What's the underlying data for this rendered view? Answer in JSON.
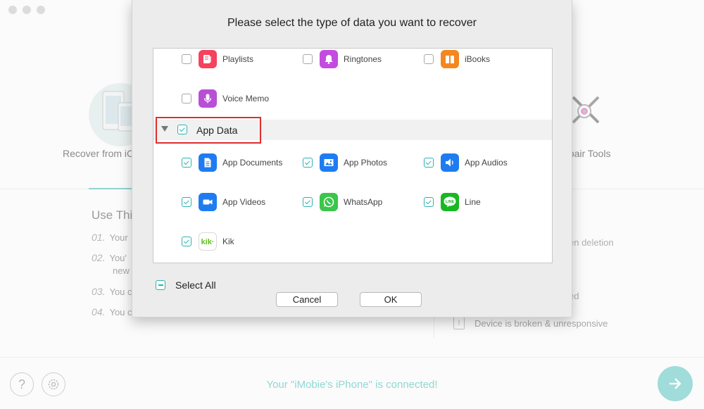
{
  "background": {
    "mode_left_label": "Recover from iC",
    "mode_right_label": "epair Tools",
    "use_heading": "Use Thi",
    "steps": [
      {
        "num": "01.",
        "text": "Your"
      },
      {
        "num": "02.",
        "text": "You'",
        "text2": "new"
      },
      {
        "num": "03.",
        "text": "You c"
      },
      {
        "num": "04.",
        "text": "You c"
      }
    ],
    "right_items": [
      "en deletion",
      "ed"
    ],
    "broken_text": "Device is broken & unresponsive",
    "status": "Your \"iMobie's iPhone\" is connected!"
  },
  "dialog": {
    "title": "Please select the type of data you want to recover",
    "group": {
      "label": "App Data",
      "checked": true
    },
    "top_items": [
      {
        "label": "Playlists",
        "checked": false,
        "icon": "playlists-icon",
        "color": "#f5425e"
      },
      {
        "label": "Ringtones",
        "checked": false,
        "icon": "ringtones-icon",
        "color": "#c44be0"
      },
      {
        "label": "iBooks",
        "checked": false,
        "icon": "ibooks-icon",
        "color": "#f4871f"
      },
      {
        "label": "Voice Memo",
        "checked": false,
        "icon": "voice-memo-icon",
        "color": "#b84fd6"
      }
    ],
    "app_items": [
      {
        "label": "App Documents",
        "checked": true,
        "icon": "app-documents-icon",
        "color": "#1f7cf0"
      },
      {
        "label": "App Photos",
        "checked": true,
        "icon": "app-photos-icon",
        "color": "#1f7cf0"
      },
      {
        "label": "App Audios",
        "checked": true,
        "icon": "app-audios-icon",
        "color": "#1f7cf0"
      },
      {
        "label": "App Videos",
        "checked": true,
        "icon": "app-videos-icon",
        "color": "#1f7cf0"
      },
      {
        "label": "WhatsApp",
        "checked": true,
        "icon": "whatsapp-icon",
        "color": "#3ac64a"
      },
      {
        "label": "Line",
        "checked": true,
        "icon": "line-icon",
        "color": "#19b823"
      },
      {
        "label": "Kik",
        "checked": true,
        "icon": "kik-icon",
        "color": "#5ec01d"
      }
    ],
    "select_all_label": "Select All",
    "cancel_label": "Cancel",
    "ok_label": "OK"
  },
  "colors": {
    "accent": "#2db3b0",
    "highlight": "#e02d2d",
    "status": "#8fd8d4"
  }
}
